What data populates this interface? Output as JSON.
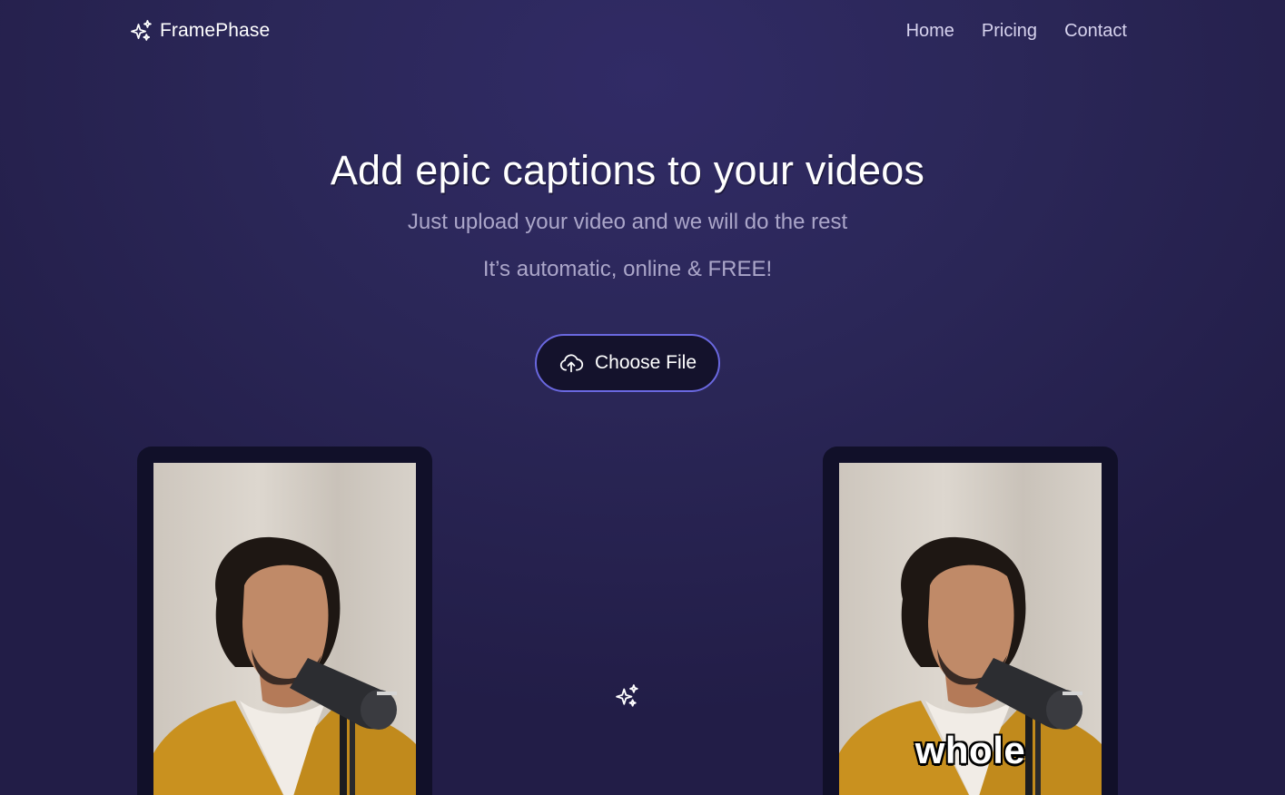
{
  "brand": {
    "name": "FramePhase",
    "icon": "sparkles-icon"
  },
  "nav": {
    "items": [
      "Home",
      "Pricing",
      "Contact"
    ]
  },
  "hero": {
    "title": "Add epic captions to your videos",
    "subtitle": "Just upload your video and we will do the rest",
    "subtitle2": "It’s automatic, online & FREE!"
  },
  "upload": {
    "label": "Choose File",
    "icon": "cloud-upload-icon"
  },
  "preview": {
    "before_caption": "",
    "after_caption": "whole",
    "divider_icon": "sparkles-icon"
  },
  "colors": {
    "background": "#2b2758",
    "button_border": "#6a68e0",
    "button_bg": "#14122c",
    "frame_bg": "#111029",
    "muted_text": "#aba6c9"
  }
}
